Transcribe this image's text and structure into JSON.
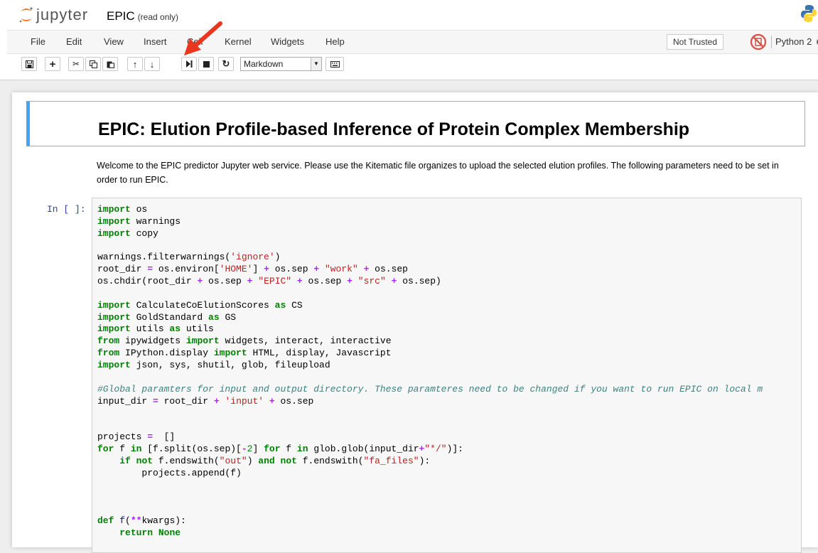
{
  "header": {
    "logo_text": "jupyter",
    "notebook_title": "EPIC",
    "read_only": "(read only)"
  },
  "menu": {
    "items": [
      "File",
      "Edit",
      "View",
      "Insert",
      "Cell",
      "Kernel",
      "Widgets",
      "Help"
    ],
    "trust_status": "Not Trusted",
    "kernel_name": "Python 2"
  },
  "toolbar": {
    "buttons": [
      "save",
      "insert-cell-below",
      "cut",
      "copy",
      "paste",
      "move-up",
      "move-down",
      "run",
      "interrupt",
      "restart",
      "command-palette"
    ],
    "cell_type": "Markdown"
  },
  "notebook": {
    "heading": "EPIC: Elution Profile-based Inference of Protein Complex Membership",
    "paragraph": "Welcome to the EPIC predictor Jupyter web service. Please use the Kitematic file organizes to upload the selected elution profiles. The following parameters need to be set in order to run EPIC.",
    "prompt": "In [ ]:",
    "code": [
      "import os",
      "import warnings",
      "import copy",
      "",
      "warnings.filterwarnings('ignore')",
      "root_dir = os.environ['HOME'] + os.sep + \"work\" + os.sep",
      "os.chdir(root_dir + os.sep + \"EPIC\" + os.sep + \"src\" + os.sep)",
      "",
      "import CalculateCoElutionScores as CS",
      "import GoldStandard as GS",
      "import utils as utils",
      "from ipywidgets import widgets, interact, interactive",
      "from IPython.display import HTML, display, Javascript",
      "import json, sys, shutil, glob, fileupload",
      "",
      "#Global paramters for input and output directory. These paramteres need to be changed if you want to run EPIC on local m",
      "input_dir = root_dir + 'input' + os.sep",
      "",
      "",
      "projects =  []",
      "for f in [f.split(os.sep)[-2] for f in glob.glob(input_dir+\"*/\")]:",
      "    if not f.endswith(\"out\") and not f.endswith(\"fa_files\"):",
      "        projects.append(f)",
      "",
      "",
      "",
      "def f(**kwargs):",
      "    return None"
    ]
  },
  "colors": {
    "accent": "#42a5f5",
    "prompt": "#303f9f",
    "keyword": "#008000",
    "string": "#ba2121",
    "operator": "#aa22ff",
    "comment": "#408080",
    "arrow": "#e8361f"
  }
}
